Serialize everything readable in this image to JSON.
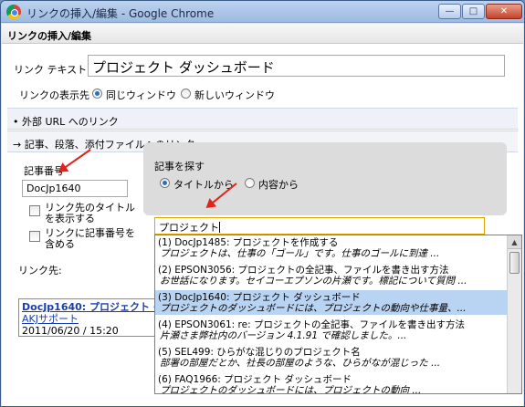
{
  "window": {
    "title": "リンクの挿入/編集 - Google Chrome",
    "min": "—",
    "max": "□",
    "close": "✕"
  },
  "dialog": {
    "heading": "リンクの挿入/編集"
  },
  "link_text": {
    "label": "リンク テキスト",
    "value": "プロジェクト ダッシュボード"
  },
  "display_target": {
    "label": "リンクの表示先",
    "same_window": "同じウィンドウ",
    "new_window": "新しいウィンドウ"
  },
  "sections": {
    "external": "• 外部 URL へのリンク",
    "internal": "→ 記事、段落、添付ファイルへのリンク"
  },
  "article_number": {
    "label": "記事番号",
    "value": "DocJp1640",
    "show_title": "リンク先のタイトル\nを表示する",
    "include_number": "リンクに記事番号を\n含める"
  },
  "link_dest": {
    "label": "リンク先:",
    "line1": "DocJp1640: プロジェクト ダ",
    "line2": "AKJサポート",
    "line3": "2011/06/20 / 15:20"
  },
  "search": {
    "label": "記事を探す",
    "by_title": "タイトルから",
    "by_content": "内容から",
    "value": "プロジェクト"
  },
  "results": [
    {
      "l1": "(1) DocJp1485: プロジェクトを作成する",
      "l2": "プロジェクトは、仕事の「ゴール」です。仕事のゴールに到達 ..."
    },
    {
      "l1": "(2) EPSON3056: プロジェクトの全記事、ファイルを書き出す方法",
      "l2": "お世話になります。セイコーエプソンの片瀬です。標記について質問 ..."
    },
    {
      "l1": "(3) DocJp1640: プロジェクト ダッシュボード",
      "l2": "プロジェクトのダッシュボードには、プロジェクトの動向や仕事量、..."
    },
    {
      "l1": "(4) EPSON3061: re: プロジェクトの全記事、ファイルを書き出す方法",
      "l2": "片瀬さま弊社内のバージョン 4.1.91 で確認しました。..."
    },
    {
      "l1": "(5) SEL499: ひらがな混じりのプロジェクト名",
      "l2": "部署の部屋だとか、社長の部屋のような、ひらがなが混じった ..."
    },
    {
      "l1": "(6) FAQ1966: プロジェクト ダッシュボード",
      "l2": "プロジェクトのダッシュボードには、プロジェクトの動向 ..."
    }
  ],
  "colors": {
    "accent": "#2a6fb8",
    "selection": "#b9d3f2",
    "arrow": "#e0241b"
  }
}
